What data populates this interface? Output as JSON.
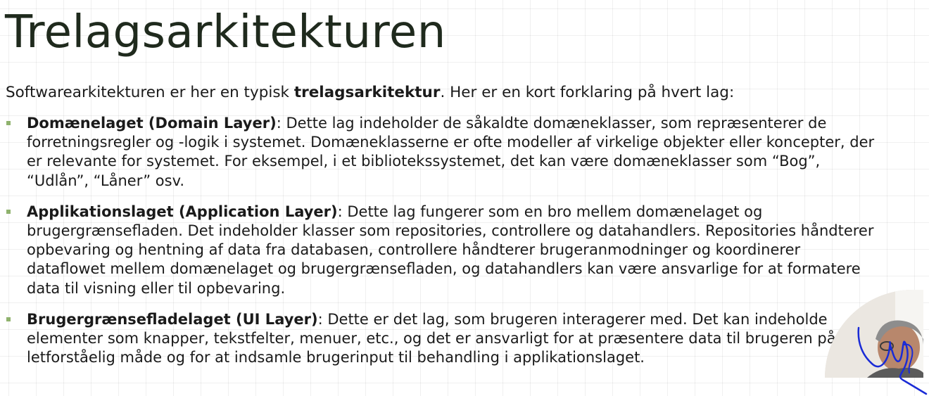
{
  "slide": {
    "title": "Trelagsarkitekturen",
    "intro": {
      "before": "Softwarearkitekturen er her en typisk ",
      "emphasis": "trelagsarkitektur",
      "after": ". Her er en kort forklaring på hvert lag:"
    },
    "layers": [
      {
        "name": "Domænelaget (Domain Layer)",
        "description": ": Dette lag indeholder de såkaldte domæneklasser, som repræsenterer de forretningsregler og -logik i systemet. Domæneklasserne er ofte modeller af virkelige objekter eller koncepter, der er relevante for systemet. For eksempel, i et bibliotekssystemet, det kan være domæneklasser som “Bog”, “Udlån”, “Låner” osv."
      },
      {
        "name": "Applikationslaget (Application Layer)",
        "description": ": Dette lag fungerer som en bro mellem domænelaget og brugergrænsefladen. Det indeholder klasser som repositories, controllere og datahandlers. Repositories håndterer opbevaring og hentning af data fra databasen, controllere håndterer brugeranmodninger og koordinerer dataflowet mellem domænelaget og brugergrænsefladen, og datahandlers kan være ansvarlige for at formatere data til visning eller til opbevaring."
      },
      {
        "name": "Brugergrænsefladelaget (UI Layer)",
        "description": ": Dette er det lag, som brugeren interagerer med. Det kan indeholde elementer som knapper, tekstfelter, menuer, etc., og det er ansvarligt for at præsentere data til brugeren på en letforståelig måde og for at indsamle brugerinput til behandling i applikationslaget."
      }
    ]
  },
  "colors": {
    "title": "#1f2a1d",
    "bullet": "#8fb26d",
    "body_text": "#1a1a1a",
    "pen_ink": "#1a2bd6"
  }
}
